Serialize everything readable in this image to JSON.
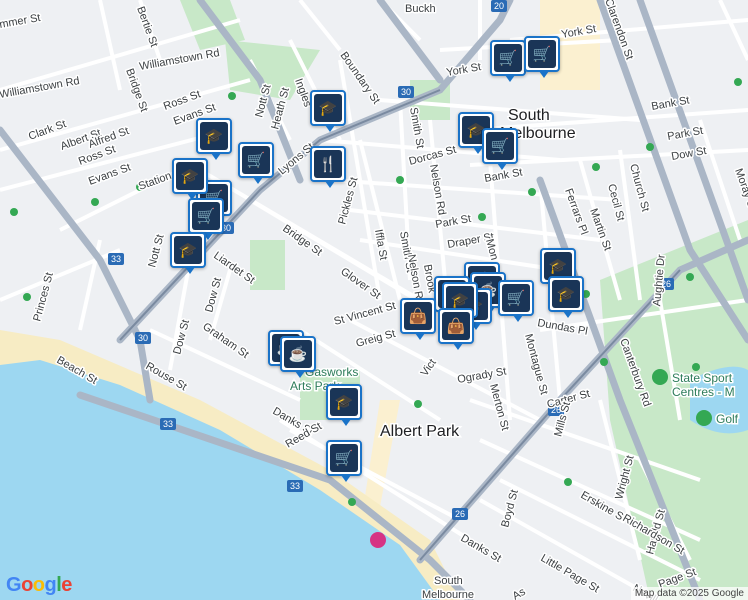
{
  "map": {
    "water_color": "#9dd7f1",
    "land_color": "#eef0f3",
    "park_color": "#c8e8c8",
    "beach_color": "#f7ecc4",
    "road_major": "#aab6c6",
    "road_minor": "#ffffff",
    "shopping_color": "#fbf0d0"
  },
  "suburbs": {
    "albert_park": "Albert Park",
    "south_melbourne_1": "South",
    "south_melbourne_2": "Melbourne",
    "south_melbourne_b1": "South",
    "south_melbourne_b2": "Melbourne"
  },
  "poi": {
    "state_sport": "State Sport",
    "state_sport_2": "Centres - M",
    "golf": "Golf",
    "gasworks_1": "Gasworks",
    "gasworks_2": "Arts Park"
  },
  "streets": {
    "williamstown_rd": "Williamstown Rd",
    "williamstown_rd_2": "Williamstown Rd",
    "bertie_st": "Bertie St",
    "rammer_st": "mmer St",
    "bridge_st": "Bridge St",
    "bridge_st_2": "Bridge St",
    "ross_st": "Ross St",
    "ross_st_2": "Ross St",
    "evans_st": "Evans St",
    "evans_st_2": "Evans St",
    "nott_st": "Nott St",
    "nott_st_2": "Nott St",
    "heath_st": "Heath St",
    "ingles_st": "Ingles",
    "boundary_st": "Boundary St",
    "clark_st": "Clark St",
    "albert_st": "Albert St",
    "alfred_st": "Alfred St",
    "station_st": "Station St",
    "lyons_st": "Lyons St",
    "pickles_st": "Pickles St",
    "dorcas_st": "Dorcas St",
    "york_st": "York St",
    "york_st_2": "York St",
    "buckhurst": "Buckh",
    "smith_st": "Smith St",
    "smith_st_2": "Smith St",
    "nelson_rd": "Nelson Rd",
    "nelson_rd_2": "Nelson Rd",
    "iffla_st": "Iffla St",
    "brooke": "Brook",
    "bank_st": "Bank St",
    "bank_st_2": "Bank St",
    "park_st": "Park St",
    "park_st_2": "Park St",
    "draper_st": "Draper St",
    "dow_st": "Dow St",
    "dow_st_2": "Dow St",
    "dow_st_3": "Dow St",
    "liardet_st": "Liardet St",
    "glover_st": "Glover St",
    "st_vincent_st": "St Vincent St",
    "greig_st": "Greig St",
    "graham_st": "Graham St",
    "princes_st": "Princes St",
    "beach_st": "Beach St",
    "rouse_st": "Rouse St",
    "danks_st": "Danks St",
    "danks_st_2": "Danks St",
    "reed_st": "Reed St",
    "ogrady_st": "Ogrady St",
    "merton_st": "Merton St",
    "montague_st": "Montague St",
    "montague_2": "Mon",
    "dundas_pl": "Dundas Pl",
    "canterbury_rd": "Canterbury Rd",
    "clarendon_st": "Clarendon St",
    "church_st": "Church St",
    "cecil_st": "Cecil St",
    "martin_st": "Martin St",
    "ferrars_pl": "Ferrars Pl",
    "moray_st": "Moray St",
    "aughtie_dr": "Aughtie Dr",
    "carter_st": "Carter St",
    "mills_st": "Mills St",
    "erskine_st": "Erskine St",
    "wright_st": "Wright St",
    "harold_st": "Harold St",
    "boyd_st": "Boyd St",
    "richardson_st": "Richardson St",
    "little_page_st": "Little Page St",
    "page_st": "Page St",
    "neville": "Nevill",
    "victoria": "Vict",
    "as_label": "As"
  },
  "route_shields": [
    "30",
    "30",
    "30",
    "33",
    "33",
    "33",
    "26",
    "26",
    "26",
    "20"
  ],
  "attribution": "Map data ©2025 Google",
  "logo": "Google",
  "markers": [
    {
      "type": "shopping-cart-icon",
      "glyph": "🛒"
    },
    {
      "type": "shopping-cart-icon",
      "glyph": "🛒"
    },
    {
      "type": "school-icon",
      "glyph": "🎓"
    },
    {
      "type": "school-icon",
      "glyph": "🎓"
    },
    {
      "type": "shopping-cart-icon",
      "glyph": "🛒"
    },
    {
      "type": "restaurant-icon",
      "glyph": "🍴"
    },
    {
      "type": "school-icon",
      "glyph": "🎓"
    },
    {
      "type": "shopping-cart-icon",
      "glyph": "🛒"
    },
    {
      "type": "shopping-cart-icon",
      "glyph": "🛒"
    },
    {
      "type": "school-icon",
      "glyph": "🎓"
    },
    {
      "type": "shopping-cart-icon",
      "glyph": "🛒"
    },
    {
      "type": "school-icon",
      "glyph": "🎓"
    },
    {
      "type": "school-icon",
      "glyph": "🎓"
    },
    {
      "type": "school-icon",
      "glyph": "🎓"
    },
    {
      "type": "cafe-icon",
      "glyph": "☕"
    },
    {
      "type": "shopping-bag-icon",
      "glyph": "👜"
    },
    {
      "type": "cafe-icon",
      "glyph": "☕"
    },
    {
      "type": "shopping-cart-icon",
      "glyph": "🛒"
    },
    {
      "type": "school-icon",
      "glyph": "🎓"
    },
    {
      "type": "school-icon",
      "glyph": "🎓"
    },
    {
      "type": "shopping-bag-icon",
      "glyph": "👜"
    },
    {
      "type": "shopping-bag-icon",
      "glyph": "👜"
    },
    {
      "type": "cafe-icon",
      "glyph": "☕"
    },
    {
      "type": "cafe-icon",
      "glyph": "☕"
    },
    {
      "type": "school-icon",
      "glyph": "🎓"
    },
    {
      "type": "shopping-cart-icon",
      "glyph": "🛒"
    }
  ]
}
